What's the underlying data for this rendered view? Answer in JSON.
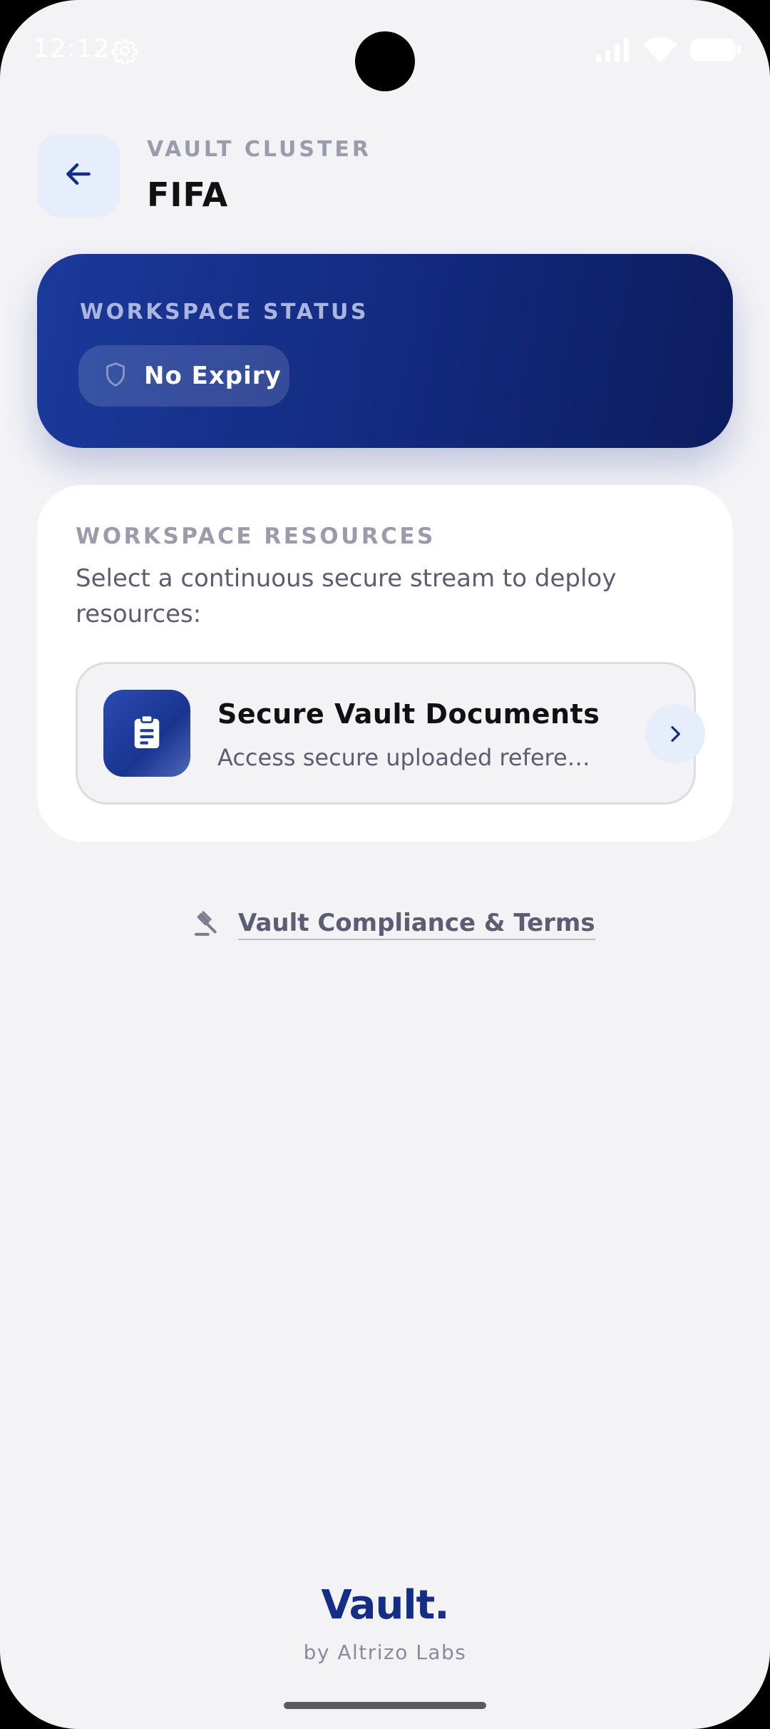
{
  "status_bar": {
    "time": "12:12",
    "icons": [
      "gear-icon",
      "signal-icon",
      "wifi-icon",
      "battery-icon"
    ]
  },
  "header": {
    "back_icon": "arrow-left-icon",
    "eyebrow": "VAULT CLUSTER",
    "title": "FIFA"
  },
  "workspace_status": {
    "label": "WORKSPACE STATUS",
    "icon": "shield-icon",
    "value": "No Expiry"
  },
  "workspace_resources": {
    "label": "WORKSPACE RESOURCES",
    "description": "Select a continuous secure stream to deploy resources:",
    "items": [
      {
        "icon": "clipboard-icon",
        "title": "Secure Vault Documents",
        "subtitle": "Access secure uploaded references",
        "chevron_icon": "chevron-right-icon"
      }
    ]
  },
  "compliance": {
    "icon": "gavel-icon",
    "label": "Vault Compliance & Terms"
  },
  "footer": {
    "brand": "Vault.",
    "byline": "by Altrizo Labs"
  },
  "colors": {
    "accent": "#142d86",
    "background": "#f3f3f6",
    "card": "#ffffff",
    "muted_text": "#9b9bab"
  }
}
